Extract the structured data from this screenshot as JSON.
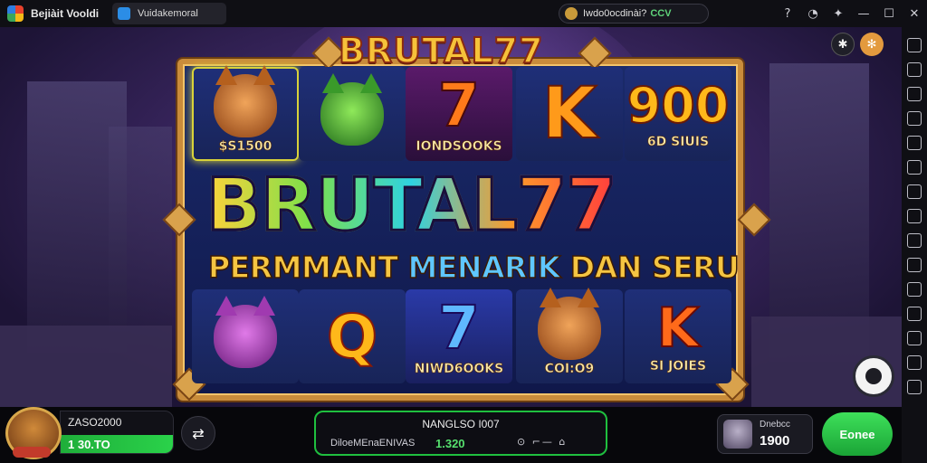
{
  "window": {
    "app_title": "Bejiàit Vooldi",
    "tab_label": "Vuidakemoral",
    "promo_text": "Iwdo0ocdinài?",
    "promo_accent": "CCV",
    "toolbar_icons": [
      "help-icon",
      "bell-icon",
      "puzzle-icon",
      "minimize-icon",
      "maximize-icon",
      "close-icon"
    ]
  },
  "sidebar": {
    "icons": [
      "expand-icon",
      "grid-icon",
      "keyboard-icon",
      "record-icon",
      "screenshot-icon",
      "volume-icon",
      "camera-icon",
      "folder-icon",
      "layers-icon",
      "settings-icon",
      "shake-icon",
      "location-icon",
      "more-icon",
      "back-icon",
      "home-icon"
    ]
  },
  "game": {
    "frame_title": "BRUTAL77",
    "big_title": "BRUTAL77",
    "subtitle_left": "PERMMANT ",
    "subtitle_mid": "MENARIK",
    "subtitle_right": " DAN SERU",
    "top_badges": [
      "puzzle-badge-icon",
      "settings-badge-icon"
    ],
    "reels": [
      {
        "symbol": "cat-orange",
        "caption": "$S1500",
        "lit": true
      },
      {
        "symbol": "cat-green",
        "caption": ""
      },
      {
        "symbol": "seven-fire",
        "caption": "IONDSOOKS"
      },
      {
        "symbol": "letter-k",
        "text": "K",
        "caption": ""
      },
      {
        "symbol": "number",
        "text": "900",
        "caption": "6D SIUIS"
      },
      {
        "symbol": "cat-purple",
        "caption": ""
      },
      {
        "symbol": "letter-q",
        "text": "Q",
        "caption": ""
      },
      {
        "symbol": "seven-blue",
        "caption": "NIWD6OOKS"
      },
      {
        "symbol": "cat-orange",
        "caption": "COI:O9"
      },
      {
        "symbol": "letter-k",
        "text": "K",
        "caption": "SI JOIES"
      }
    ]
  },
  "bottom": {
    "balance_label": "ZASO2000",
    "balance_value": "1 30.TO",
    "center_title": "NANGLSO I007",
    "center_label": "DiloeMEnaENIVAS",
    "center_value": "1.320",
    "bet_label": "Dnebcc",
    "bet_value": "1900",
    "action_label": "Eonee"
  },
  "colors": {
    "accent_green": "#1fbf3f",
    "frame_gold": "#c98c3b",
    "title_gold": "#f6c23a"
  }
}
